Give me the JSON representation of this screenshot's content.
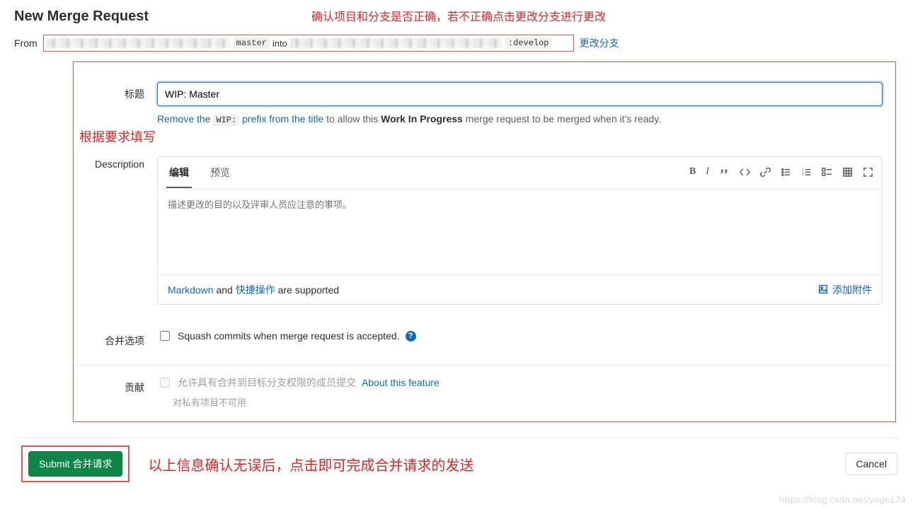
{
  "page": {
    "title": "New Merge Request"
  },
  "annotations": {
    "top": "确认项目和分支是否正确，若不正确点击更改分支进行更改",
    "middle": "根据要求填写",
    "bottom": "以上信息确认无误后，点击即可完成合并请求的发送"
  },
  "from": {
    "label": "From",
    "source_branch": "master",
    "into": "into",
    "target_branch": ":develop",
    "change_branches": "更改分支"
  },
  "form": {
    "title_label": "标题",
    "title_value": "WIP: Master",
    "wip_hint": {
      "remove": "Remove the",
      "wip_code": "WIP:",
      "middle": "prefix from the title",
      "rest1": "to allow this",
      "strong": "Work In Progress",
      "rest2": "merge request to be merged when it's ready."
    },
    "description_label": "Description",
    "editor": {
      "tab_write": "编辑",
      "tab_preview": "预览",
      "placeholder": "描述更改的目的以及评审人员应注意的事项。",
      "markdown": "Markdown",
      "and": " and ",
      "quick_actions": "快捷操作",
      "supported": " are supported",
      "attach": "添加附件"
    },
    "merge_options": {
      "label": "合并选项",
      "squash": "Squash commits when merge request is accepted."
    },
    "contribution": {
      "label": "贡献",
      "allow": "允许具有合并到目标分支权限的成员提交",
      "about": "About this feature",
      "private_note": "对私有项目不可用"
    }
  },
  "actions": {
    "submit": "Submit 合并请求",
    "cancel": "Cancel"
  },
  "watermark": "https://blog.csdn.net/yage124"
}
